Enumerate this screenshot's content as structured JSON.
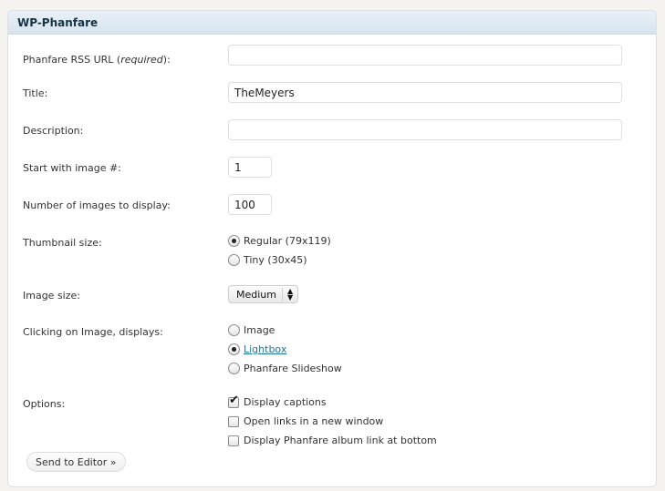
{
  "panel": {
    "title": "WP-Phanfare"
  },
  "fields": {
    "rss_url": {
      "label_prefix": "Phanfare RSS URL (",
      "label_emphasis": "required",
      "label_suffix": "):",
      "value": ""
    },
    "title": {
      "label": "Title:",
      "value": "TheMeyers"
    },
    "description": {
      "label": "Description:",
      "value": ""
    },
    "start_image": {
      "label": "Start with image #:",
      "value": "1"
    },
    "num_images": {
      "label": "Number of images to display:",
      "value": "100"
    },
    "thumbnail_size": {
      "label": "Thumbnail size:",
      "options": [
        {
          "label": "Regular (79x119)",
          "selected": true
        },
        {
          "label": "Tiny (30x45)",
          "selected": false
        }
      ]
    },
    "image_size": {
      "label": "Image size:",
      "selected": "Medium",
      "arrow_glyph": "▲▼"
    },
    "click_display": {
      "label": "Clicking on Image, displays:",
      "options": [
        {
          "label": "Image",
          "selected": false
        },
        {
          "label": "Lightbox",
          "selected": true
        },
        {
          "label": "Phanfare Slideshow",
          "selected": false
        }
      ]
    },
    "options": {
      "label": "Options:",
      "items": [
        {
          "label": "Display captions",
          "checked": true
        },
        {
          "label": "Open links in a new window",
          "checked": false
        },
        {
          "label": "Display Phanfare album link at bottom",
          "checked": false
        }
      ]
    }
  },
  "actions": {
    "send_label": "Send to Editor »"
  }
}
